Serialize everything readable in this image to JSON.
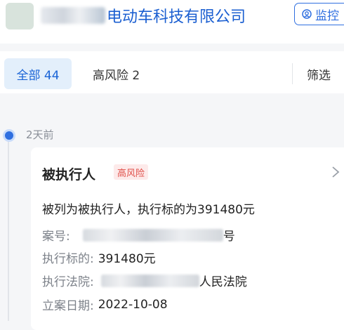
{
  "header": {
    "company_name_visible": "电动车科技有限公司",
    "monitor_label": "监控"
  },
  "filters": {
    "all_label": "全部 44",
    "high_risk_label": "高风险 2",
    "filter_label": "筛选"
  },
  "timeline": {
    "time_label": "2天前"
  },
  "card": {
    "title": "被执行人",
    "badge": "高风险",
    "summary": "被列为被执行人，执行标的为391480元",
    "case_no_label": "案号:",
    "case_no_visible_suffix": "号",
    "amount_label": "执行标的:",
    "amount_value": "391480元",
    "court_label": "执行法院:",
    "court_visible_suffix": "人民法院",
    "date_label": "立案日期:",
    "date_value": "2022-10-08"
  },
  "colors": {
    "accent": "#2f6fe0",
    "risk": "#e0514b"
  }
}
